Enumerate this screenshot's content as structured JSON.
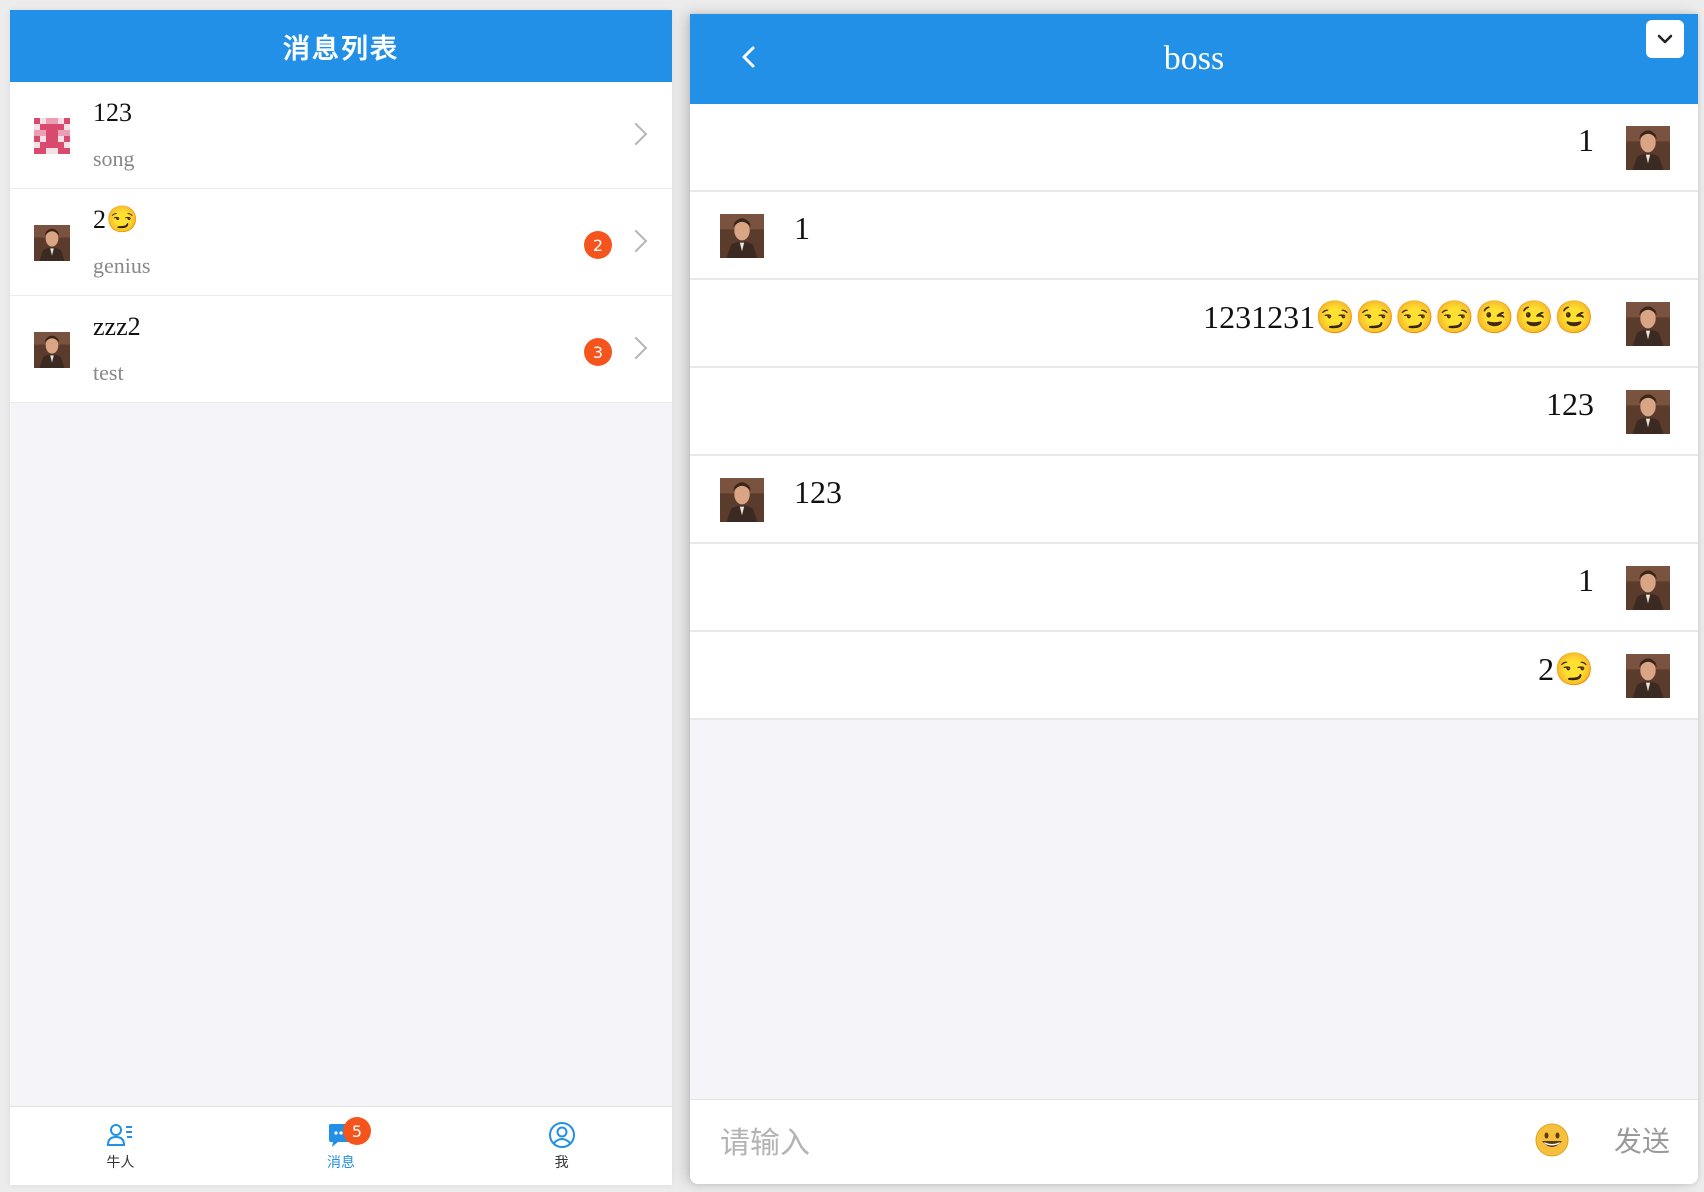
{
  "left": {
    "header_title": "消息列表",
    "conversations": [
      {
        "title": "123",
        "subtitle": "song",
        "unread": ""
      },
      {
        "title": "2😏",
        "subtitle": "genius",
        "unread": "2"
      },
      {
        "title": "zzz2",
        "subtitle": "test",
        "unread": "3"
      }
    ],
    "tabs": [
      {
        "label": "牛人",
        "icon": "user-list-icon",
        "badge": ""
      },
      {
        "label": "消息",
        "icon": "chat-icon",
        "badge": "5"
      },
      {
        "label": "我",
        "icon": "user-circle-icon",
        "badge": ""
      }
    ]
  },
  "chat": {
    "title": "boss",
    "messages": [
      {
        "from": "me",
        "text": "1"
      },
      {
        "from": "other",
        "text": "1"
      },
      {
        "from": "me",
        "text": "1231231😏😏😏😏😉😉😉"
      },
      {
        "from": "me",
        "text": "123"
      },
      {
        "from": "other",
        "text": "123"
      },
      {
        "from": "me",
        "text": "1"
      },
      {
        "from": "me",
        "text": "2😏"
      }
    ],
    "input_placeholder": "请输入",
    "send_label": "发送"
  },
  "colors": {
    "accent": "#2190e6",
    "badge": "#f5541c"
  }
}
